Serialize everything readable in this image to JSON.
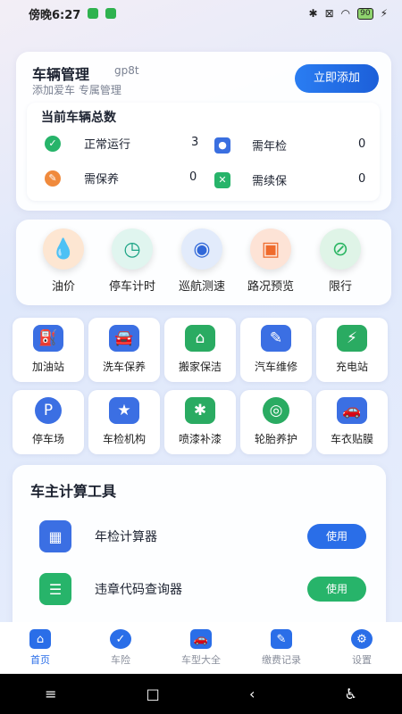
{
  "status": {
    "time": "傍晚6:27",
    "battery": "90"
  },
  "vehicle": {
    "title": "车辆管理",
    "user": "gp8t",
    "desc": "添加爱车 专属管理",
    "add_label": "立即添加",
    "summary_title": "当前车辆总数",
    "stats": [
      {
        "label": "正常运行",
        "value": "3"
      },
      {
        "label": "需年检",
        "value": "0"
      },
      {
        "label": "需保养",
        "value": "0"
      },
      {
        "label": "需续保",
        "value": "0"
      }
    ]
  },
  "quick": [
    {
      "label": "油价",
      "icon": "oil-drop-icon"
    },
    {
      "label": "停车计时",
      "icon": "clock-icon"
    },
    {
      "label": "巡航测速",
      "icon": "speedometer-icon"
    },
    {
      "label": "路况预览",
      "icon": "camera-icon"
    },
    {
      "label": "限行",
      "icon": "no-entry-icon"
    }
  ],
  "services": [
    {
      "label": "加油站",
      "icon": "gas-pump-icon"
    },
    {
      "label": "洗车保养",
      "icon": "car-wash-icon"
    },
    {
      "label": "搬家保洁",
      "icon": "moving-truck-icon"
    },
    {
      "label": "汽车维修",
      "icon": "wrench-icon"
    },
    {
      "label": "充电站",
      "icon": "ev-charger-icon"
    },
    {
      "label": "停车场",
      "icon": "parking-icon"
    },
    {
      "label": "车检机构",
      "icon": "shield-star-icon"
    },
    {
      "label": "喷漆补漆",
      "icon": "spray-gun-icon"
    },
    {
      "label": "轮胎养护",
      "icon": "tire-icon"
    },
    {
      "label": "车衣贴膜",
      "icon": "car-cover-icon"
    }
  ],
  "tools": {
    "title": "车主计算工具",
    "items": [
      {
        "label": "年检计算器",
        "button": "使用"
      },
      {
        "label": "违章代码查询器",
        "button": "使用"
      }
    ]
  },
  "tabs": [
    {
      "label": "首页",
      "icon": "home-icon"
    },
    {
      "label": "车险",
      "icon": "shield-check-icon"
    },
    {
      "label": "车型大全",
      "icon": "car-icon"
    },
    {
      "label": "缴费记录",
      "icon": "document-edit-icon"
    },
    {
      "label": "设置",
      "icon": "gear-icon"
    }
  ],
  "colors": {
    "primary": "#2a6ee8",
    "green": "#27b46a",
    "orange": "#f08a3c"
  }
}
